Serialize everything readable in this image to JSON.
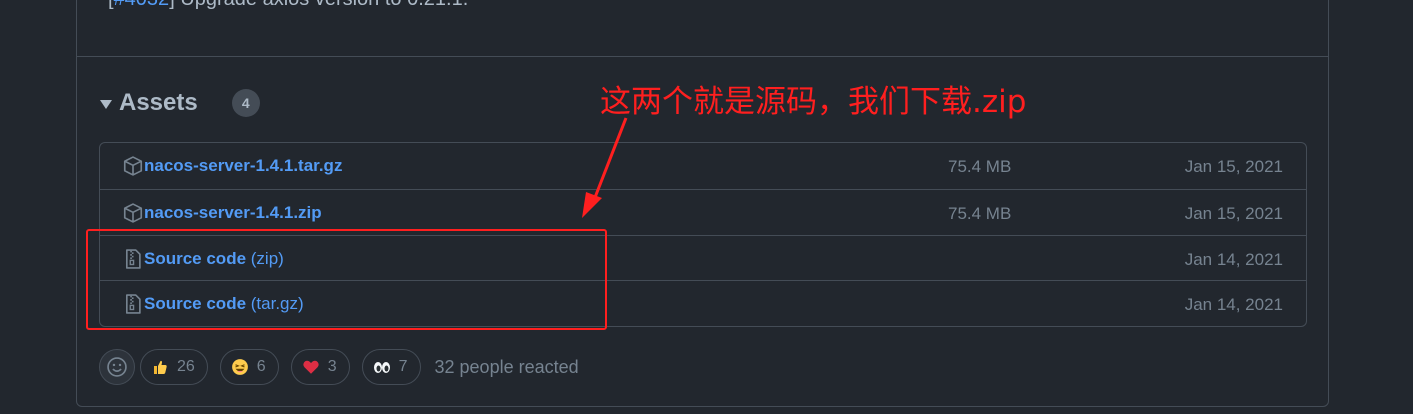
{
  "release_notes": {
    "line_prefix": "[",
    "issue_link": "#4032",
    "line_text": "] Upgrade axios version to 0.21.1."
  },
  "assets": {
    "title": "Assets",
    "count": "4",
    "items": [
      {
        "icon": "package-icon",
        "name": "nacos-server-1.4.1.tar.gz",
        "suffix": "",
        "size": "75.4 MB",
        "date": "Jan 15, 2021"
      },
      {
        "icon": "package-icon",
        "name": "nacos-server-1.4.1.zip",
        "suffix": "",
        "size": "75.4 MB",
        "date": "Jan 15, 2021"
      },
      {
        "icon": "file-zip-icon",
        "name": "Source code",
        "suffix": " (zip)",
        "size": "",
        "date": "Jan 14, 2021"
      },
      {
        "icon": "file-zip-icon",
        "name": "Source code",
        "suffix": " (tar.gz)",
        "size": "",
        "date": "Jan 14, 2021"
      }
    ]
  },
  "annotation": {
    "text": "这两个就是源码，我们下载.zip",
    "color": "#ff1f1f"
  },
  "reactions": {
    "items": [
      {
        "icon": "thumbs-up-icon",
        "count": "26"
      },
      {
        "icon": "laugh-icon",
        "count": "6"
      },
      {
        "icon": "heart-icon",
        "count": "3"
      },
      {
        "icon": "eyes-icon",
        "count": "7"
      }
    ],
    "summary": "32 people reacted"
  },
  "colors": {
    "background": "#22272e",
    "border": "#444c56",
    "link": "#539bf5",
    "muted": "#768390",
    "annotation_red": "#ff1f1f"
  }
}
